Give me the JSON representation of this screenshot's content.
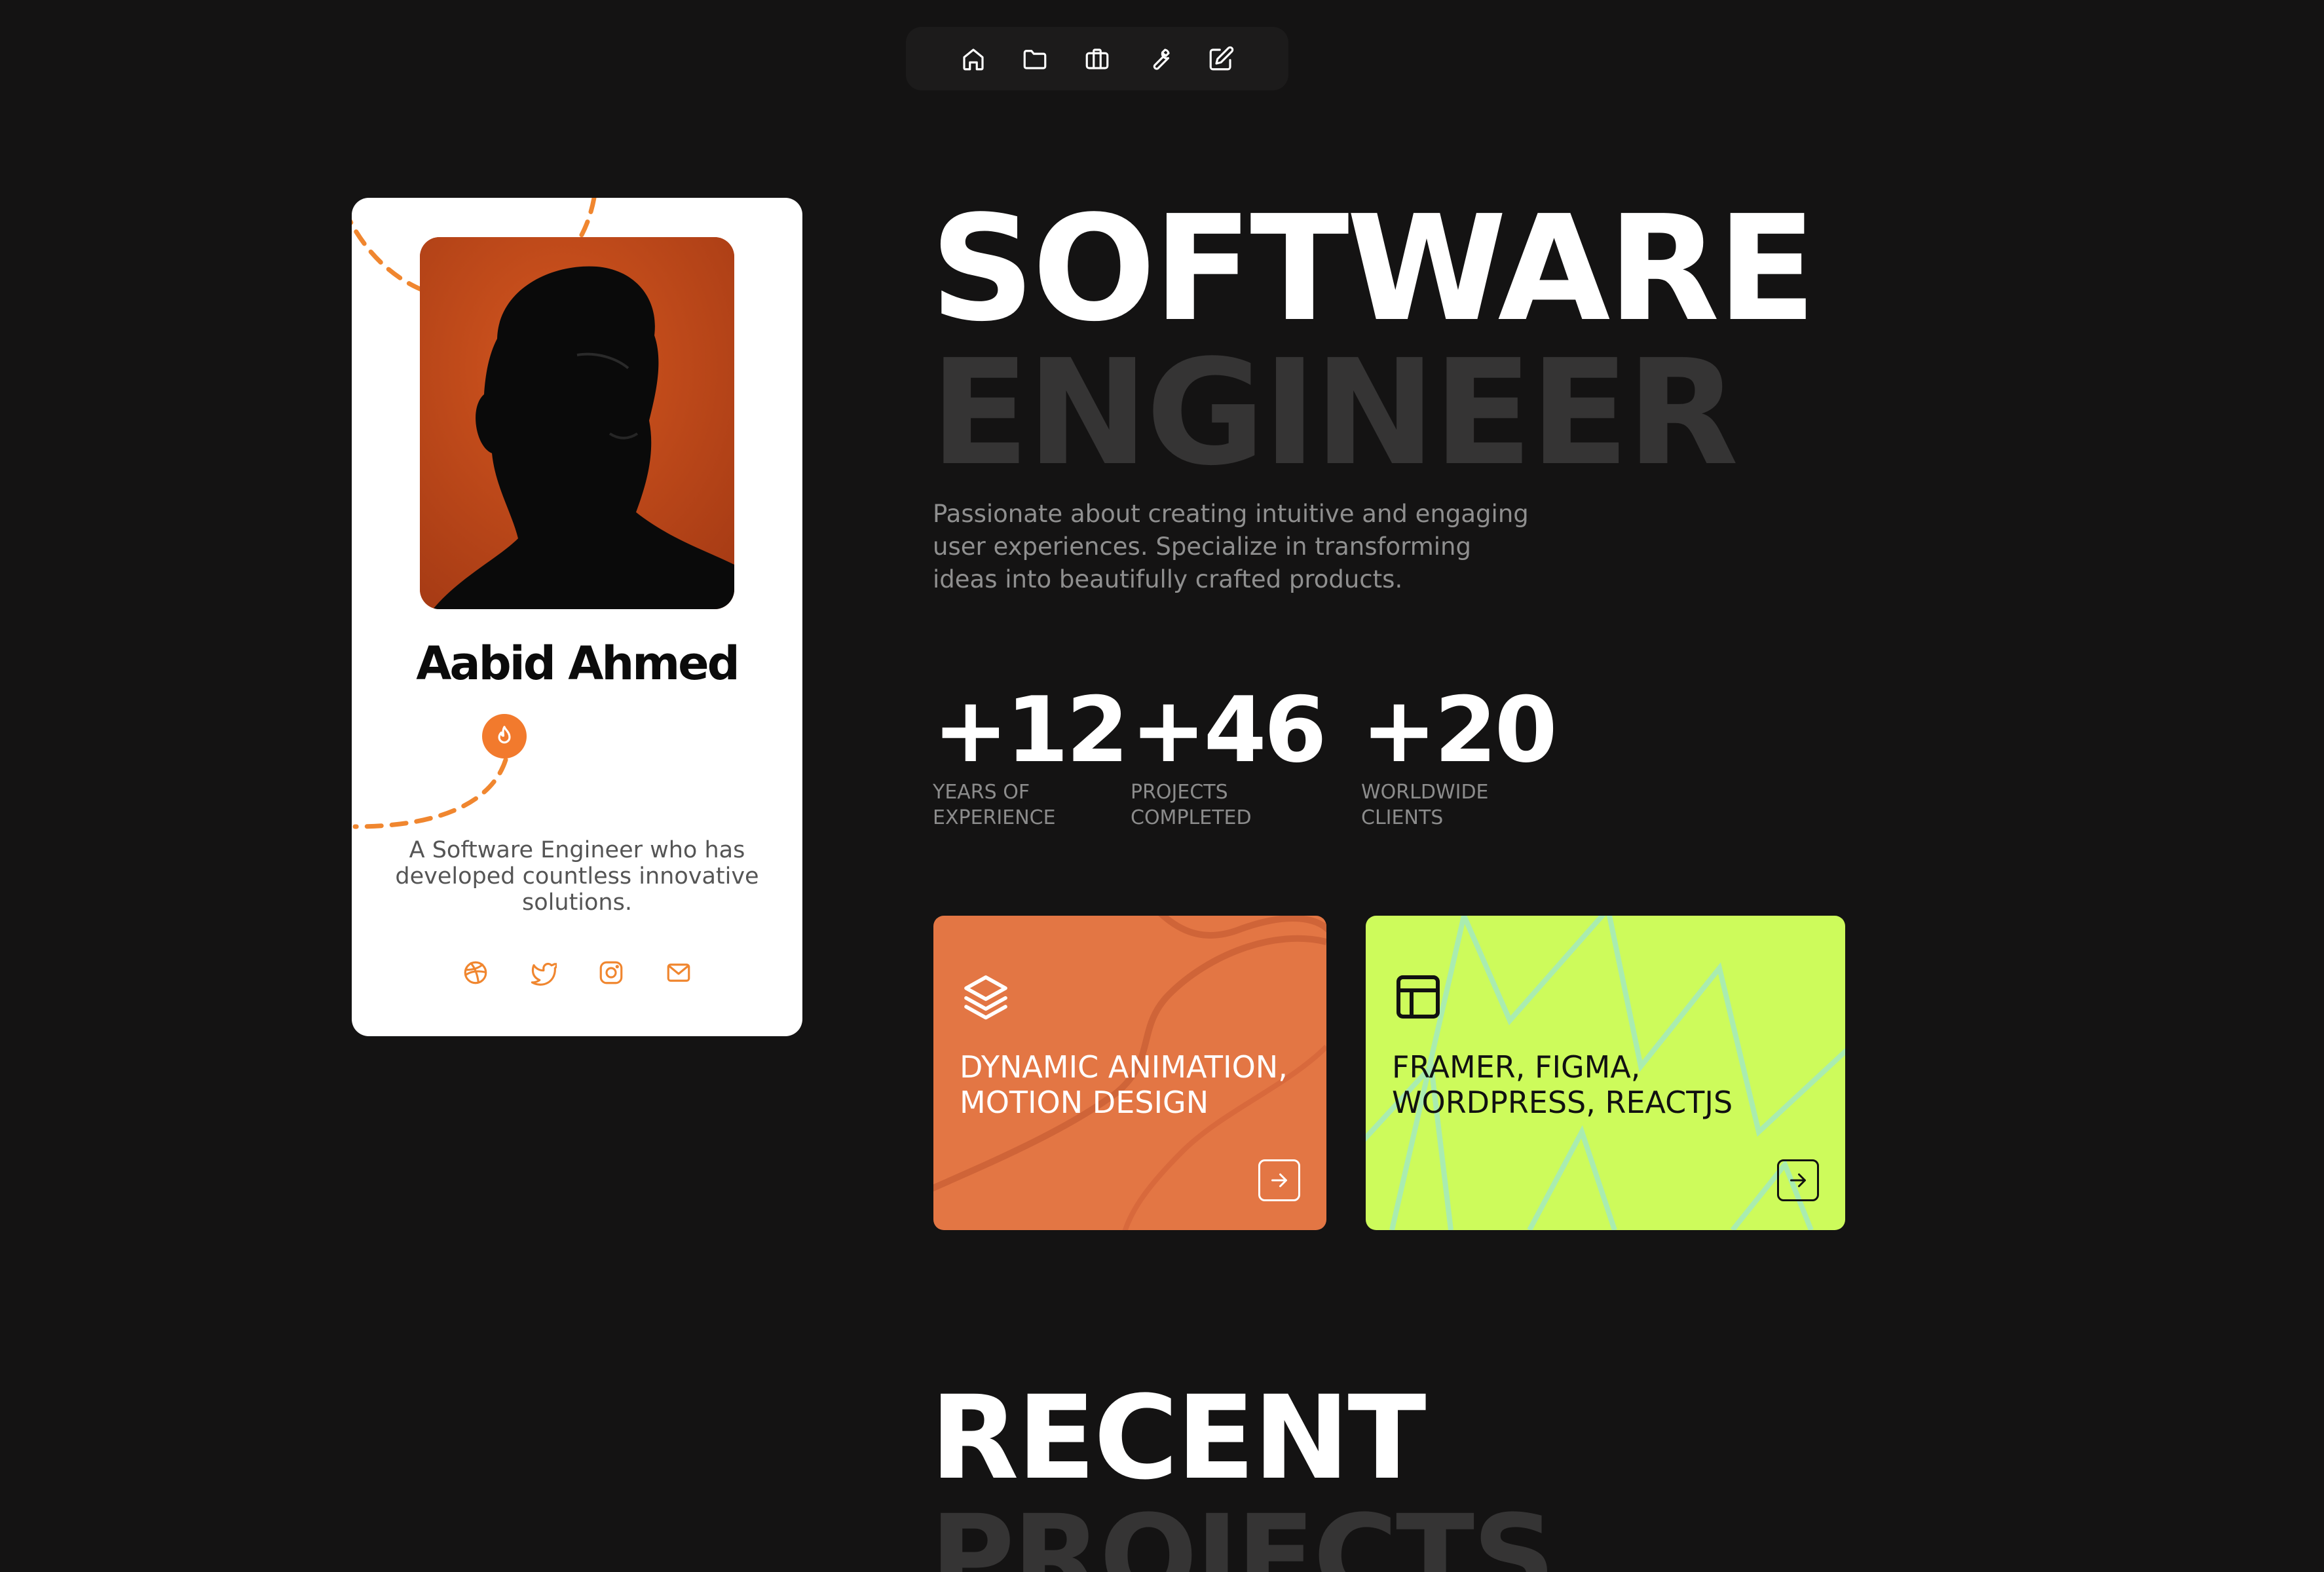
{
  "nav": {
    "items": [
      {
        "icon": "home-icon"
      },
      {
        "icon": "folder-icon"
      },
      {
        "icon": "briefcase-icon"
      },
      {
        "icon": "wrench-icon"
      },
      {
        "icon": "edit-icon"
      }
    ]
  },
  "profile": {
    "name": "Aabid Ahmed",
    "badge_icon": "fire-icon",
    "description": "A Software Engineer who has developed countless innovative solutions.",
    "socials": [
      "dribbble-icon",
      "twitter-icon",
      "instagram-icon",
      "mail-icon"
    ],
    "accent_color": "#f27a2d"
  },
  "hero": {
    "title_line_1": "SOFTWARE",
    "title_line_2": "ENGINEER",
    "description": "Passionate about creating intuitive and engaging user experiences. Specialize in transforming ideas into beautifully crafted products."
  },
  "stats": [
    {
      "value": "+12",
      "label": "YEARS OF\nEXPERIENCE"
    },
    {
      "value": "+46",
      "label": "PROJECTS\nCOMPLETED"
    },
    {
      "value": "+20",
      "label": "WORLDWIDE\nCLIENTS"
    }
  ],
  "feature_cards": [
    {
      "title": "DYNAMIC ANIMATION,\nMOTION DESIGN",
      "icon": "layers-icon",
      "background": "#e37644",
      "text_color": "#ffffff"
    },
    {
      "title": "FRAMER, FIGMA,\nWORDPRESS, REACTJS",
      "icon": "layout-icon",
      "background": "#cdfb5b",
      "text_color": "#111111"
    }
  ],
  "recent": {
    "title_line_1": "RECENT",
    "title_line_2": "PROJECTS"
  }
}
